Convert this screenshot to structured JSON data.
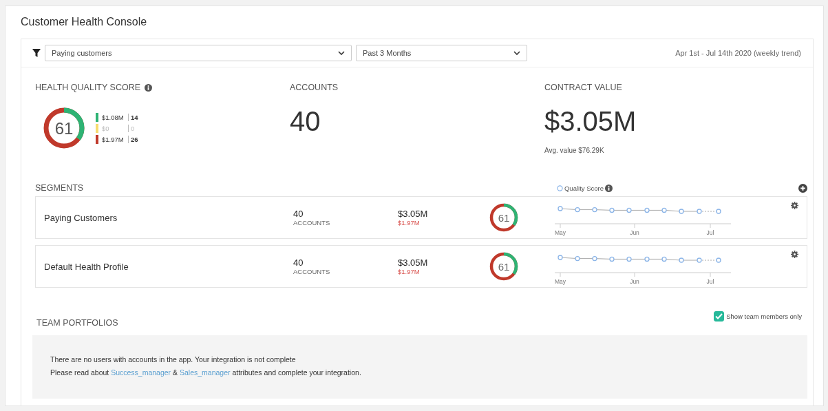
{
  "title": "Customer Health Console",
  "filters": {
    "segment": "Paying customers",
    "period": "Past 3 Months",
    "range": "Apr 1st - Jul 14th 2020 (weekly trend)"
  },
  "health": {
    "label": "HEALTH QUALITY SCORE",
    "score": "61",
    "legend": [
      {
        "value": "$1.08M",
        "count": "14",
        "color": "#2eb374",
        "muted": false
      },
      {
        "value": "$0",
        "count": "0",
        "color": "#f7dc6f",
        "muted": true
      },
      {
        "value": "$1.97M",
        "count": "26",
        "color": "#c0392b",
        "muted": false
      }
    ]
  },
  "accounts": {
    "label": "ACCOUNTS",
    "value": "40"
  },
  "contract": {
    "label": "CONTRACT VALUE",
    "value": "$3.05M",
    "note": "Avg. value $76.29K"
  },
  "segments": {
    "label": "SEGMENTS",
    "legend": "Quality Score",
    "rows": [
      {
        "name": "Paying Customers",
        "accounts": "40",
        "accounts_label": "ACCOUNTS",
        "value": "$3.05M",
        "risk": "$1.97M",
        "score": "61",
        "months": [
          "May",
          "Jun",
          "Jul"
        ]
      },
      {
        "name": "Default Health Profile",
        "accounts": "40",
        "accounts_label": "ACCOUNTS",
        "value": "$3.05M",
        "risk": "$1.97M",
        "score": "61",
        "months": [
          "May",
          "Jun",
          "Jul"
        ]
      }
    ]
  },
  "team": {
    "label": "TEAM PORTFOLIOS",
    "toggle": {
      "label": "Show team members only",
      "checked": true
    },
    "message": "There are no users with accounts in the app. Your integration is not complete",
    "hint": [
      "Please read about ",
      "Success_manager",
      " & ",
      "Sales_manager",
      " attributes and complete your integration."
    ]
  }
}
